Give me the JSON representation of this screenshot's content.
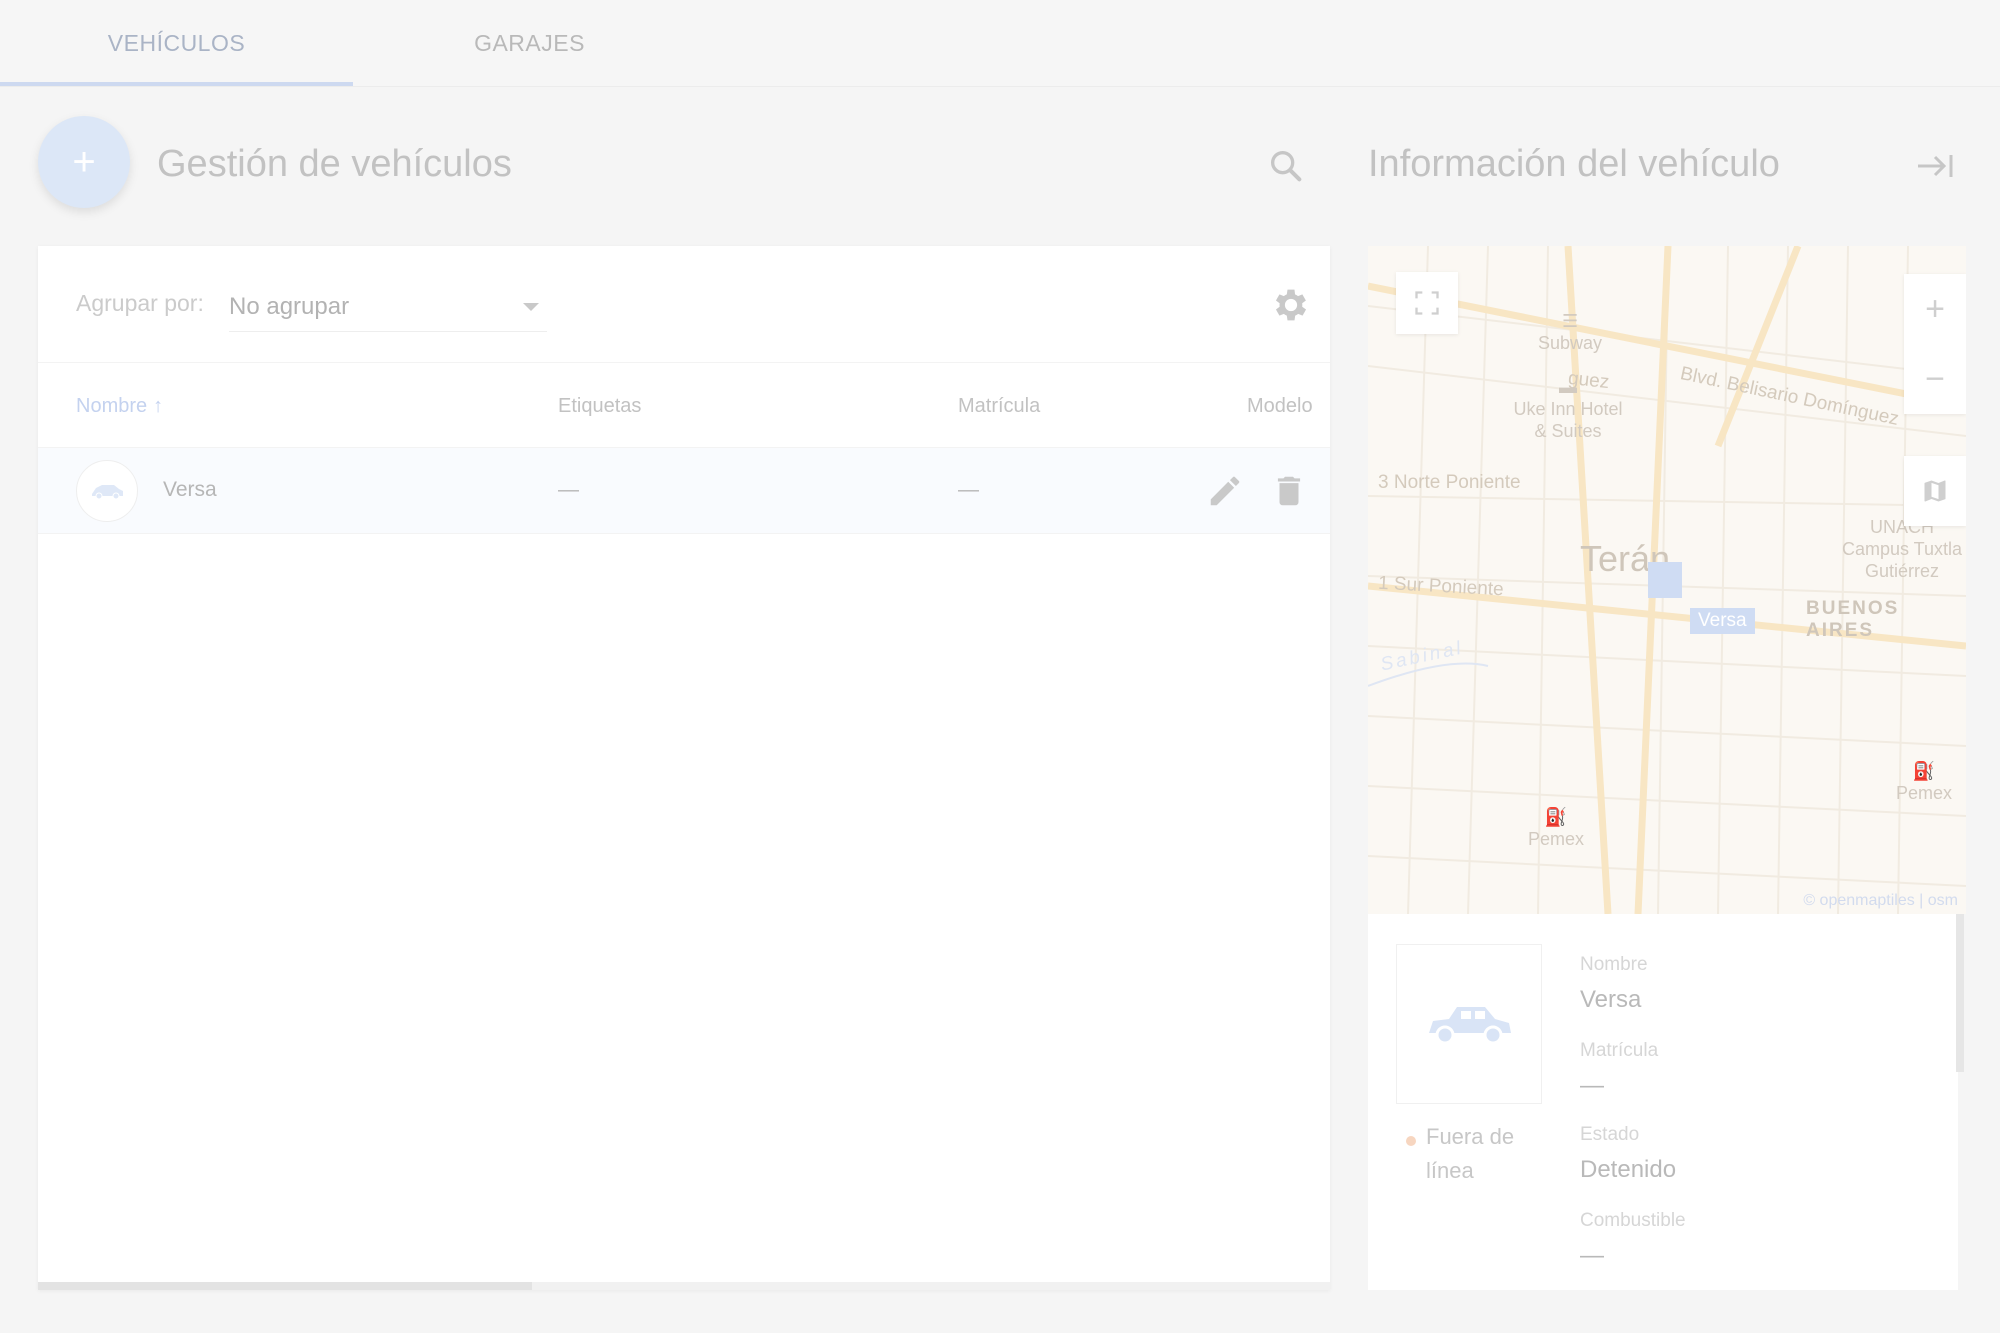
{
  "tabs": [
    {
      "label": "VEHÍCULOS",
      "active": true
    },
    {
      "label": "GARAJES",
      "active": false
    }
  ],
  "header": {
    "add_icon": "+",
    "title": "Gestión de vehículos",
    "search_icon": "search-icon"
  },
  "toolbar": {
    "group_by_label": "Agrupar por:",
    "group_by_value": "No agrupar",
    "settings_icon": "gear-icon"
  },
  "table": {
    "columns": [
      {
        "label": "Nombre",
        "sorted": "asc"
      },
      {
        "label": "Etiquetas"
      },
      {
        "label": "Matrícula"
      },
      {
        "label": "Modelo"
      }
    ],
    "rows": [
      {
        "name": "Versa",
        "tags": "—",
        "plate": "—",
        "model": ""
      }
    ]
  },
  "info_panel": {
    "title": "Información del vehículo",
    "collapse_icon": "collapse-right-icon"
  },
  "map": {
    "places": {
      "city": "Terán",
      "district": "BUENOS AIRES",
      "river": "Sabinal"
    },
    "streets": [
      "Blvd. Belisario Domínguez",
      "3 Norte Poniente",
      "1 Sur Poniente",
      "guez"
    ],
    "pois": [
      "Subway",
      "Uke Inn Hotel & Suites",
      "UNACH Campus Tuxtla Gutiérrez",
      "Pemex",
      "Pemex"
    ],
    "vehicle_label": "Versa",
    "attribution": "© openmaptiles | osm",
    "controls": {
      "zoom_in": "+",
      "zoom_out": "−"
    }
  },
  "details": {
    "status": "Fuera de línea",
    "status_color": "#f5a36b",
    "fields": [
      {
        "label": "Nombre",
        "value": "Versa"
      },
      {
        "label": "Matrícula",
        "value": "—"
      },
      {
        "label": "Estado",
        "value": "Detenido"
      },
      {
        "label": "Combustible",
        "value": "—"
      }
    ]
  },
  "colors": {
    "accent": "#8fb2ea",
    "background": "#f5f5f5"
  }
}
